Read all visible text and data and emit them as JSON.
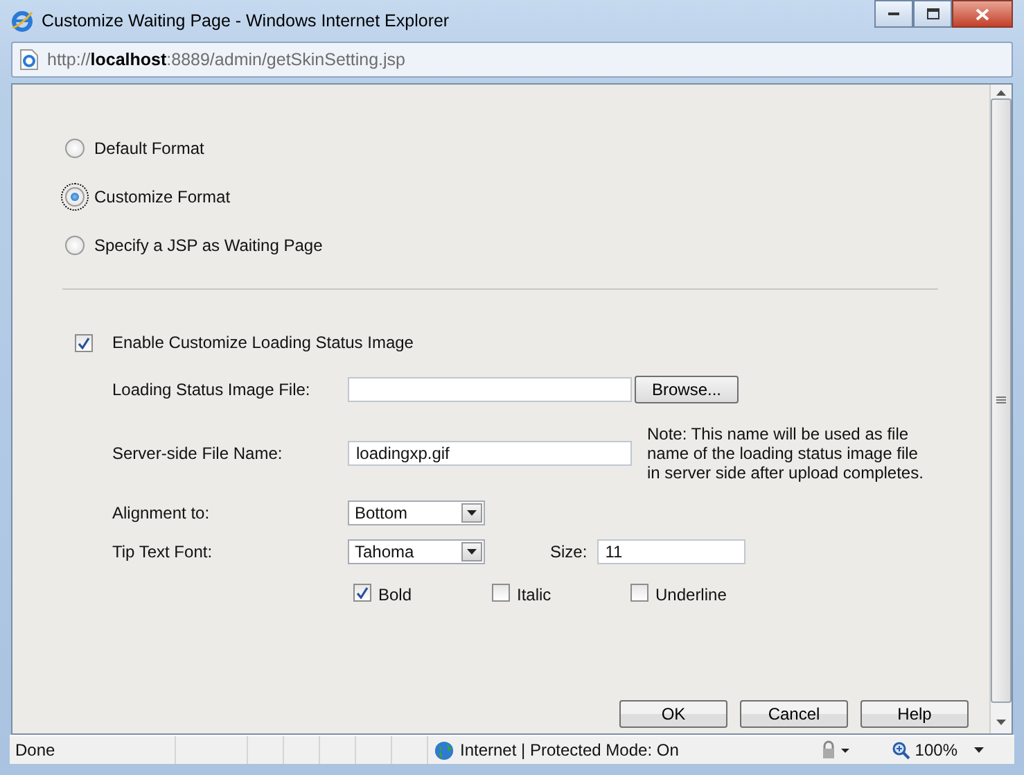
{
  "window": {
    "title": "Customize Waiting Page - Windows Internet Explorer"
  },
  "address_bar": {
    "url": "http://**localhost**:8889/admin/getSkinSetting.jsp"
  },
  "format_options": [
    {
      "label": "Default Format",
      "selected": false
    },
    {
      "label": "Customize Format",
      "selected": true
    },
    {
      "label": "Specify a JSP as Waiting Page",
      "selected": false
    }
  ],
  "enable_image": {
    "label": "Enable Customize Loading Status Image",
    "checked": true
  },
  "image_file": {
    "label": "Loading Status Image File:",
    "button": "Browse..."
  },
  "server_file": {
    "label": "Server-side File Name:",
    "value": "loadingxp.gif",
    "note": "Note: This name will be used as file name of the loading status image file in server side after upload completes."
  },
  "alignment": {
    "label": "Alignment to:",
    "value": "Bottom"
  },
  "tip_font": {
    "label": "Tip Text Font:",
    "value": "Tahoma",
    "size_label": "Size:",
    "size": "11"
  },
  "styles": [
    {
      "label": "Bold",
      "checked": true
    },
    {
      "label": "Italic",
      "checked": false
    },
    {
      "label": "Underline",
      "checked": false
    }
  ],
  "buttons": [
    "OK",
    "Cancel",
    "Help"
  ],
  "status_bar": {
    "text": "Done",
    "zone": "Internet | Protected Mode: On",
    "zoom": "100%"
  }
}
